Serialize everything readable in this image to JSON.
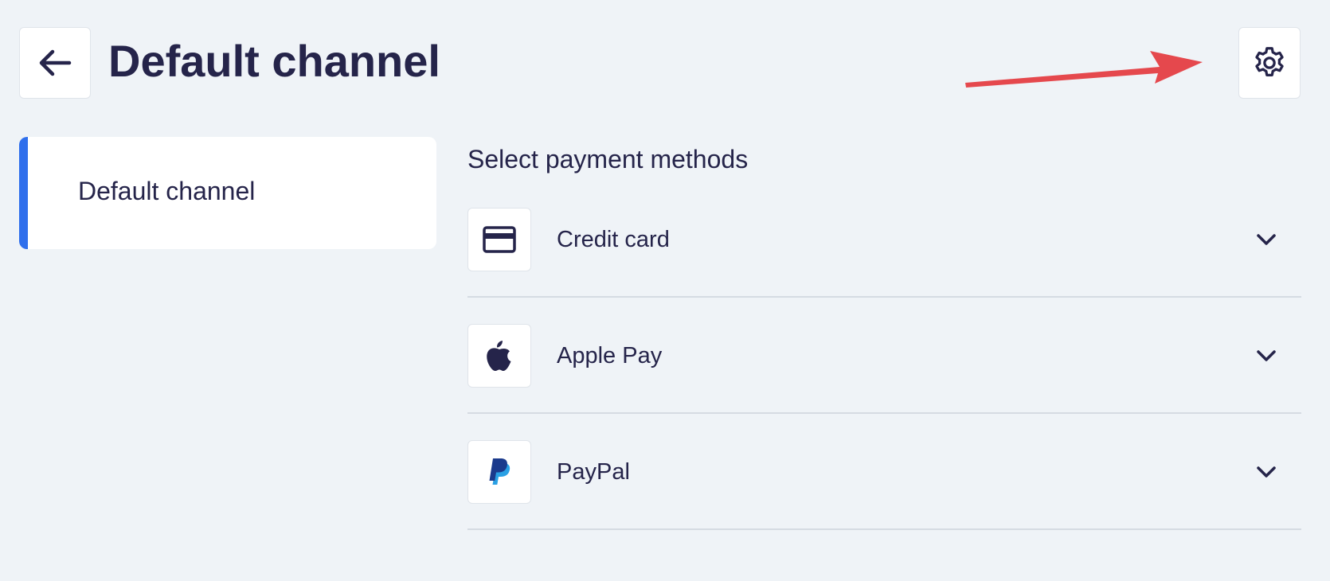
{
  "header": {
    "title": "Default channel",
    "back_icon": "arrow-left-icon",
    "settings_icon": "gear-icon"
  },
  "annotation": {
    "arrow_color": "#e5484d"
  },
  "sidebar": {
    "items": [
      {
        "label": "Default channel",
        "selected": true
      }
    ],
    "accent_color": "#2f6fec"
  },
  "main": {
    "section_title": "Select payment methods",
    "methods": [
      {
        "label": "Credit card",
        "icon": "credit-card-icon"
      },
      {
        "label": "Apple Pay",
        "icon": "apple-icon"
      },
      {
        "label": "PayPal",
        "icon": "paypal-icon"
      }
    ]
  },
  "colors": {
    "background": "#eff3f7",
    "text": "#25244a",
    "accent": "#2f6fec"
  }
}
